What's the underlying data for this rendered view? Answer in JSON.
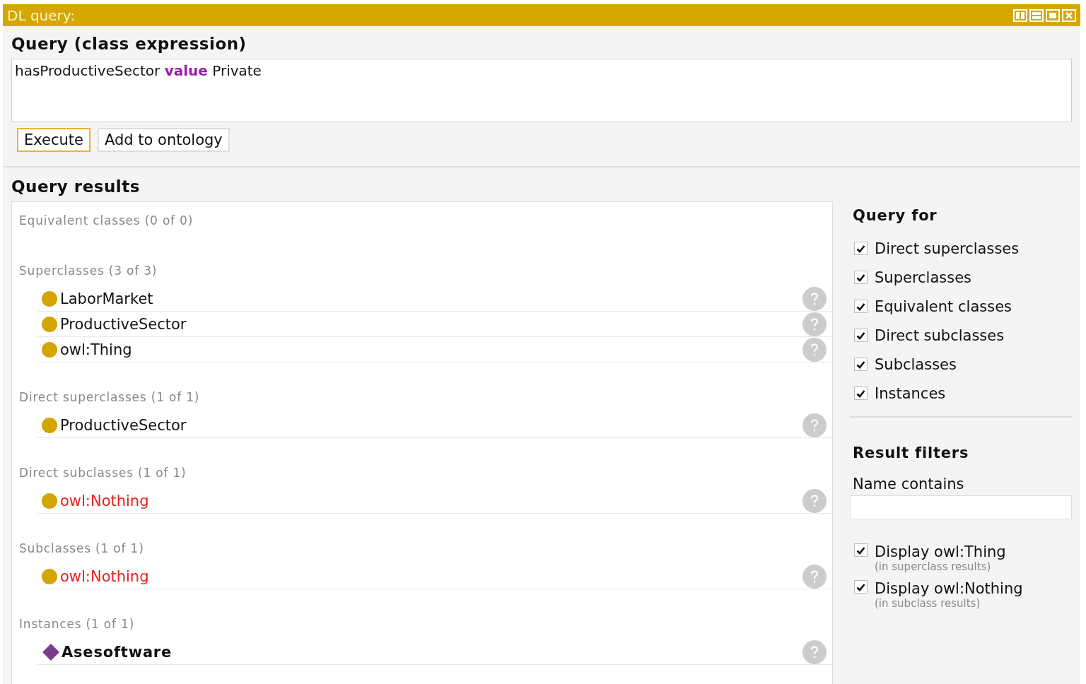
{
  "window": {
    "title": "DL query:"
  },
  "query": {
    "heading": "Query (class expression)",
    "expression": "hasProductiveSector **value** Private",
    "buttons": [
      {
        "label": "Execute",
        "selected": true
      },
      {
        "label": "Add to ontology",
        "selected": false
      }
    ]
  },
  "results": {
    "heading": "Query results",
    "sections": [
      {
        "label": "Equivalent classes (0 of 0)"
      },
      {
        "label": "Superclasses (3 of 3)",
        "items": [
          {
            "kind": "class",
            "name": "LaborMarket",
            "unsatisfiable": false
          },
          {
            "kind": "class",
            "name": "ProductiveSector",
            "unsatisfiable": false
          },
          {
            "kind": "class",
            "name": "owl:Thing",
            "unsatisfiable": false
          }
        ]
      },
      {
        "label": "Direct superclasses (1 of 1)",
        "items": [
          {
            "kind": "class",
            "name": "ProductiveSector",
            "unsatisfiable": false
          }
        ]
      },
      {
        "label": "Direct subclasses (1 of 1)",
        "items": [
          {
            "kind": "class",
            "name": "owl:Nothing",
            "unsatisfiable": true
          }
        ]
      },
      {
        "label": "Subclasses (1 of 1)",
        "items": [
          {
            "kind": "class",
            "name": "owl:Nothing",
            "unsatisfiable": true
          }
        ]
      },
      {
        "label": "Instances (1 of 1)",
        "items": [
          {
            "kind": "individual",
            "name": "Asesoftware",
            "unsatisfiable": false
          }
        ]
      }
    ]
  },
  "query_for": {
    "heading": "Query for",
    "options": [
      {
        "label": "Direct superclasses",
        "checked": true
      },
      {
        "label": "Superclasses",
        "checked": true
      },
      {
        "label": "Equivalent classes",
        "checked": true
      },
      {
        "label": "Direct subclasses",
        "checked": true
      },
      {
        "label": "Subclasses",
        "checked": true
      },
      {
        "label": "Instances",
        "checked": true
      }
    ]
  },
  "result_filters": {
    "heading": "Result filters",
    "name_contains": {
      "label": "Name contains"
    },
    "options": [
      {
        "label": "Display owl:Thing",
        "note": "(in superclass results)",
        "checked": true
      },
      {
        "label": "Display owl:Nothing",
        "note": "(in subclass results)",
        "checked": true
      }
    ]
  }
}
